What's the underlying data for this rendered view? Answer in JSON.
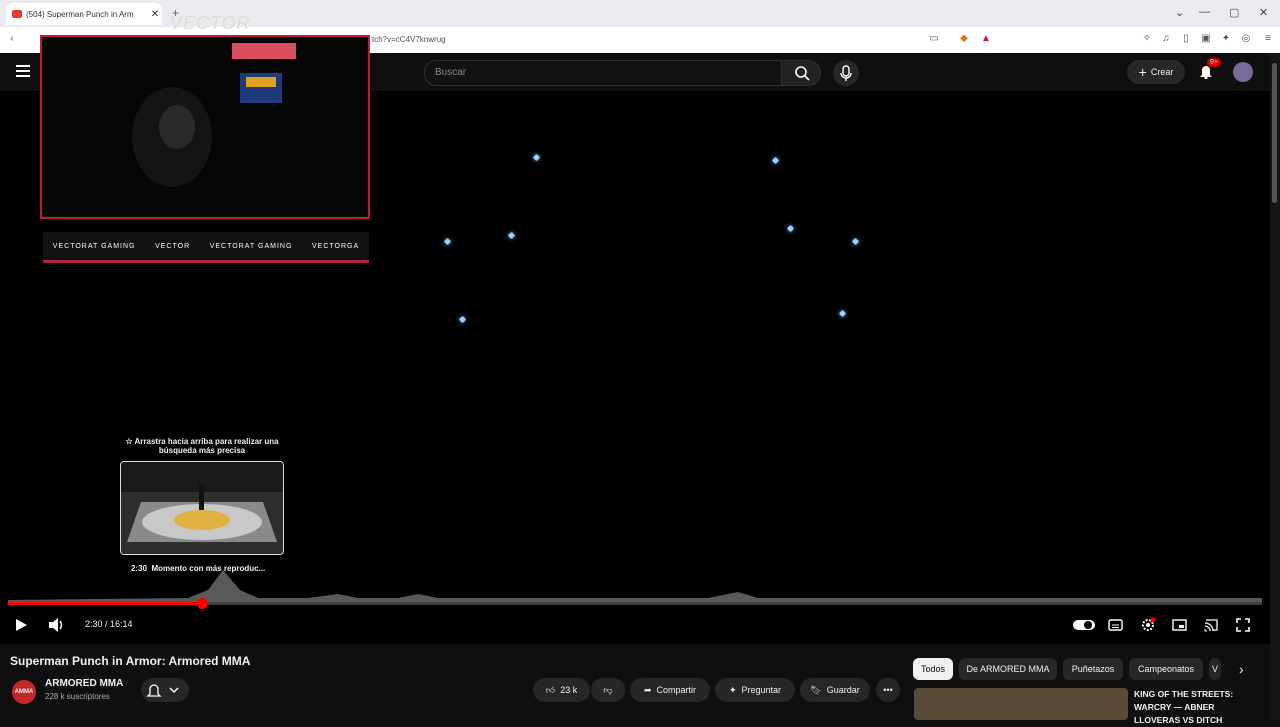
{
  "browser": {
    "tab_title": "(504) Superman Punch in Arm",
    "tab_close": "✕",
    "new_tab": "+",
    "url": "tch?v=cC4V7knwrug",
    "controls": {
      "minimize": "—",
      "maximize": "▢",
      "close": "✕",
      "dropdown": "⌄"
    }
  },
  "youtube": {
    "search_placeholder": "Buscar",
    "create_label": "Crear",
    "notifications_badge": "9+"
  },
  "stream_overlay": {
    "word": "VECTOR",
    "socials": [
      "VECTORAT GAMING",
      "VECTOR",
      "VECTORAT GAMING",
      "VECTORGA"
    ]
  },
  "player": {
    "seek_hint": "☆ Arrastra hacia arriba para realizar una búsqueda más precisa",
    "preview_time": "2:30",
    "preview_label": "Momento con más reproduc...",
    "time_display": "2:30 / 16:14",
    "progress_fraction": 0.155,
    "accent_color": "#ff0000"
  },
  "video": {
    "title": "Superman Punch in Armor: Armored MMA",
    "channel_name": "ARMORED MMA",
    "channel_logo_text": "AMMA",
    "subscribers": "228 k suscriptores",
    "likes": "23 k",
    "share_label": "Compartir",
    "ask_label": "Preguntar",
    "save_label": "Guardar"
  },
  "chips": [
    "Todos",
    "De ARMORED MMA",
    "Puñetazos",
    "Campeonatos",
    "V"
  ],
  "recommendation": {
    "title": "KING OF THE STREETS: WARCRY — ABNER LLOVERAS VS DITCH"
  }
}
